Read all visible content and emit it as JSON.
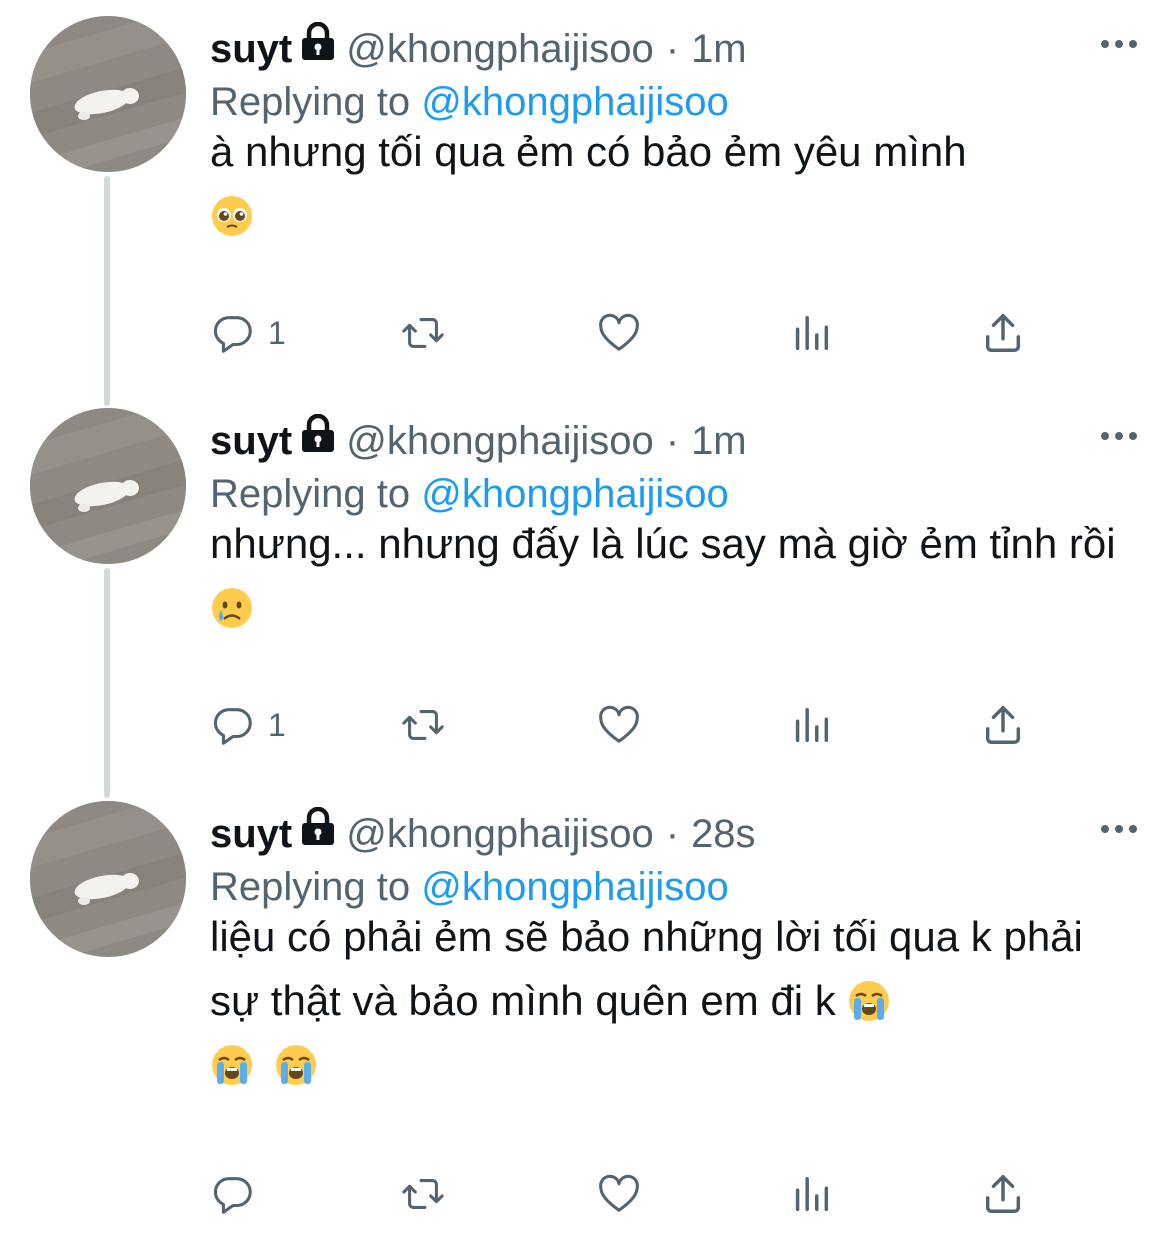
{
  "tweets": [
    {
      "name": "suyt",
      "handle": "@khongphaijisoo",
      "separator": "·",
      "time": "1m",
      "replying_prefix": "Replying to",
      "replying_to": "@khongphaijisoo",
      "text": "à nhưng tối qua ẻm có bảo ẻm yêu mình",
      "emojis": [
        "pleading-face"
      ],
      "reply_count": "1"
    },
    {
      "name": "suyt",
      "handle": "@khongphaijisoo",
      "separator": "·",
      "time": "1m",
      "replying_prefix": "Replying to",
      "replying_to": "@khongphaijisoo",
      "text": "nhưng... nhưng đấy là lúc say mà giờ ẻm tỉnh rồi",
      "emojis": [
        "crying-face"
      ],
      "reply_count": "1"
    },
    {
      "name": "suyt",
      "handle": "@khongphaijisoo",
      "separator": "·",
      "time": "28s",
      "replying_prefix": "Replying to",
      "replying_to": "@khongphaijisoo",
      "text": "liệu có phải ẻm sẽ bảo những lời tối qua k phải sự thật và bảo mình quên em đi k",
      "emojis": [
        "loudly-crying-face",
        "loudly-crying-face",
        "loudly-crying-face"
      ],
      "reply_count": ""
    }
  ],
  "colors": {
    "text": "#0f1419",
    "secondary": "#536471",
    "link": "#1d9bf0",
    "thread_line": "#cfd9de"
  }
}
